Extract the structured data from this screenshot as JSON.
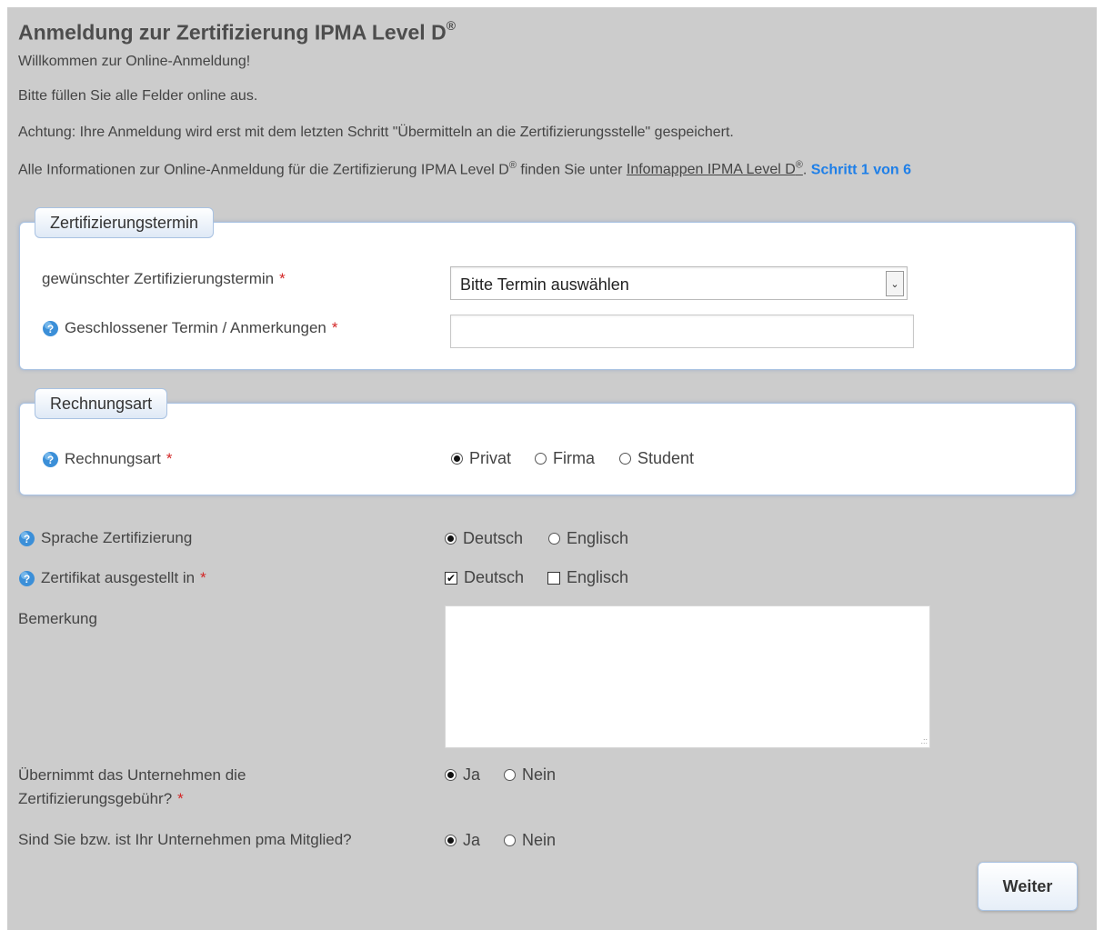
{
  "header": {
    "title": "Anmeldung zur Zertifizierung IPMA Level D",
    "title_reg": "®",
    "welcome": "Willkommen zur Online-Anmeldung!",
    "instruction": "Bitte füllen Sie alle Felder online aus.",
    "warning": "Achtung: Ihre Anmeldung wird erst mit dem letzten Schritt \"Übermitteln an die Zertifizierungsstelle\" gespeichert.",
    "info_prefix": "Alle Informationen zur Online-Anmeldung für die Zertifizierung IPMA Level D",
    "info_reg": "®",
    "info_middle": " finden Sie unter ",
    "info_link": "Infomappen IPMA Level D",
    "info_link_reg": "®",
    "info_suffix": ".",
    "step": "Schritt 1 von 6"
  },
  "section_termin": {
    "legend": "Zertifizierungstermin",
    "termin_label": "gewünschter Zertifizierungstermin",
    "termin_value": "Bitte Termin auswählen",
    "closed_label": "Geschlossener Termin / Anmerkungen",
    "closed_value": ""
  },
  "section_rechnung": {
    "legend": "Rechnungsart",
    "label": "Rechnungsart",
    "options": [
      "Privat",
      "Firma",
      "Student"
    ],
    "selected": "Privat"
  },
  "sprache": {
    "label": "Sprache Zertifizierung",
    "options": [
      "Deutsch",
      "Englisch"
    ],
    "selected": "Deutsch"
  },
  "zertifikat": {
    "label": "Zertifikat ausgestellt in",
    "options": [
      "Deutsch",
      "Englisch"
    ],
    "checked": [
      "Deutsch"
    ]
  },
  "bemerkung": {
    "label": "Bemerkung",
    "value": ""
  },
  "gebuehr": {
    "label_line1": "Übernimmt das Unternehmen die",
    "label_line2": "Zertifizierungsgebühr?",
    "options": [
      "Ja",
      "Nein"
    ],
    "selected": "Ja"
  },
  "mitglied": {
    "label": "Sind Sie bzw. ist Ihr Unternehmen pma Mitglied?",
    "options": [
      "Ja",
      "Nein"
    ],
    "selected": "Ja"
  },
  "required_marker": "*",
  "next_button": "Weiter",
  "colors": {
    "background": "#cccccc",
    "step": "#1e7fe8",
    "required": "#d32626",
    "border": "#a9c2e2"
  },
  "icons": {
    "help": "help-icon",
    "select_arrow": "chevron-down-icon"
  }
}
